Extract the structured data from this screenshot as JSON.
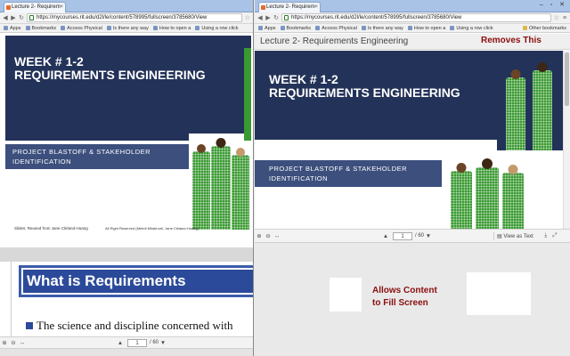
{
  "left": {
    "tab_title": "Lecture 2- Requirem",
    "url": "https://mycourses.rit.edu/d2l/le/content/578995/fullscreen/3785680/View",
    "bookmarks": [
      "Apps",
      "Bookmarks",
      "Access Physical",
      "Is there any way",
      "How to open a",
      "Using a row click"
    ],
    "slide1": {
      "title_line1": "WEEK # 1-2",
      "title_line2": "REQUIREMENTS ENGINEERING",
      "subtitle_line1": "PROJECT BLASTOFF & STAKEHOLDER",
      "subtitle_line2": "IDENTIFICATION",
      "footer_left": "Slides: Reused from Jane Cleland-Huang",
      "footer_right": "All Right Reserved (Mehdi Mirakhorli, Jane Cleland-Huang)"
    },
    "slide2": {
      "heading": "What is Requirements",
      "bullet": "The science and discipline concerned with"
    },
    "toolbar": {
      "page": "1",
      "total": "/ 60",
      "zoom_in": "+",
      "zoom_out": "-"
    }
  },
  "right": {
    "tab_title": "Lecture 2- Requirem",
    "url": "https://mycourses.rit.edu/d2l/le/content/578995/fullscreen/3785680/View",
    "bookmarks": [
      "Apps",
      "Bookmarks",
      "Access Physical",
      "Is there any way",
      "How to open a",
      "Using a row click"
    ],
    "other_bookmarks": "Other bookmarks",
    "doc_title": "Lecture 2- Requirements Engineering",
    "slide": {
      "title_line1": "WEEK # 1-2",
      "title_line2": "REQUIREMENTS ENGINEERING",
      "subtitle_line1": "PROJECT BLASTOFF & STAKEHOLDER",
      "subtitle_line2": "IDENTIFICATION"
    },
    "toolbar": {
      "page": "1",
      "total": "/ 60",
      "view_as_text": "View as Text"
    }
  },
  "annotations": {
    "removes": "Removes This",
    "allows_line1": "Allows Content",
    "allows_line2": "to Fill Screen"
  },
  "colors": {
    "navy": "#233258",
    "subtitle_band": "#3c4f7d",
    "annotation_red": "#8b0d0d",
    "tab_bar": "#a8c3e6"
  }
}
